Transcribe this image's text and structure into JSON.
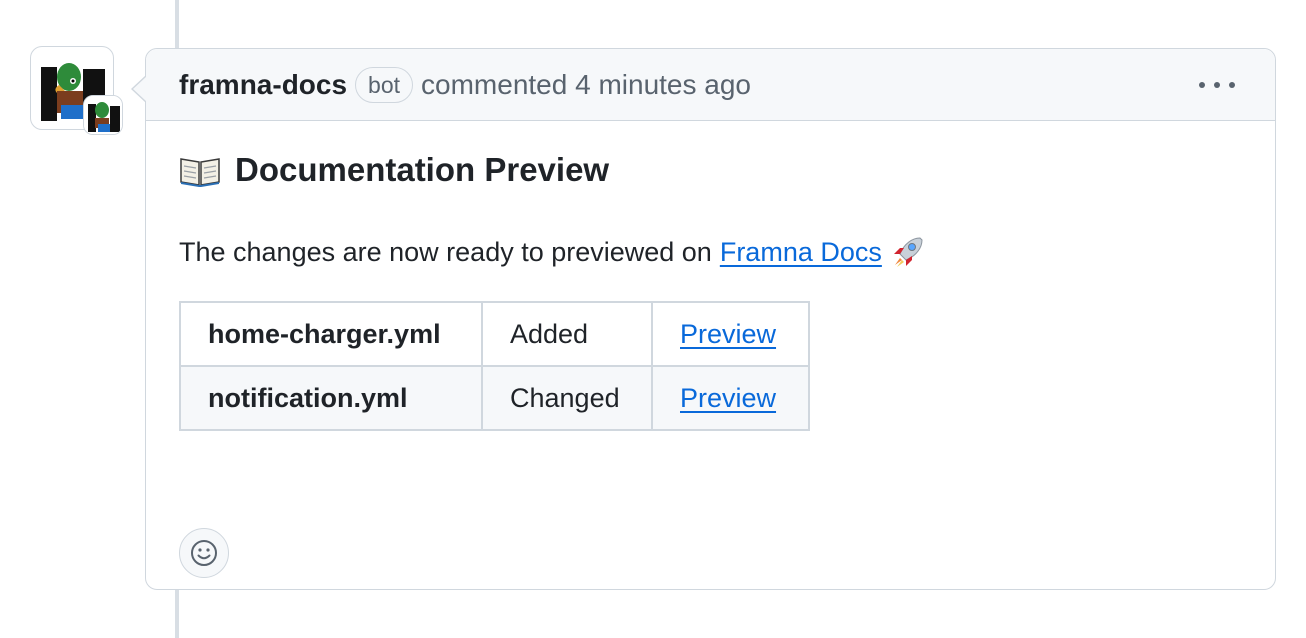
{
  "comment": {
    "author": "framna-docs",
    "badge": "bot",
    "action_text": "commented 4 minutes ago",
    "menu_icon": "kebab-horizontal-icon"
  },
  "body": {
    "heading_icon": "open-book-icon",
    "heading": "Documentation Preview",
    "intro_text": "The changes are now ready to previewed on",
    "intro_link": "Framna Docs",
    "intro_trailing_icon": "rocket-icon",
    "table": {
      "rows": [
        {
          "file": "home-charger.yml",
          "status": "Added",
          "link": "Preview"
        },
        {
          "file": "notification.yml",
          "status": "Changed",
          "link": "Preview"
        }
      ]
    },
    "reaction_icon": "smiley-icon"
  },
  "colors": {
    "link": "#0969da",
    "border": "#d0d7de",
    "header_bg": "#f6f8fa",
    "muted_text": "#59636e",
    "text": "#1f2328"
  }
}
